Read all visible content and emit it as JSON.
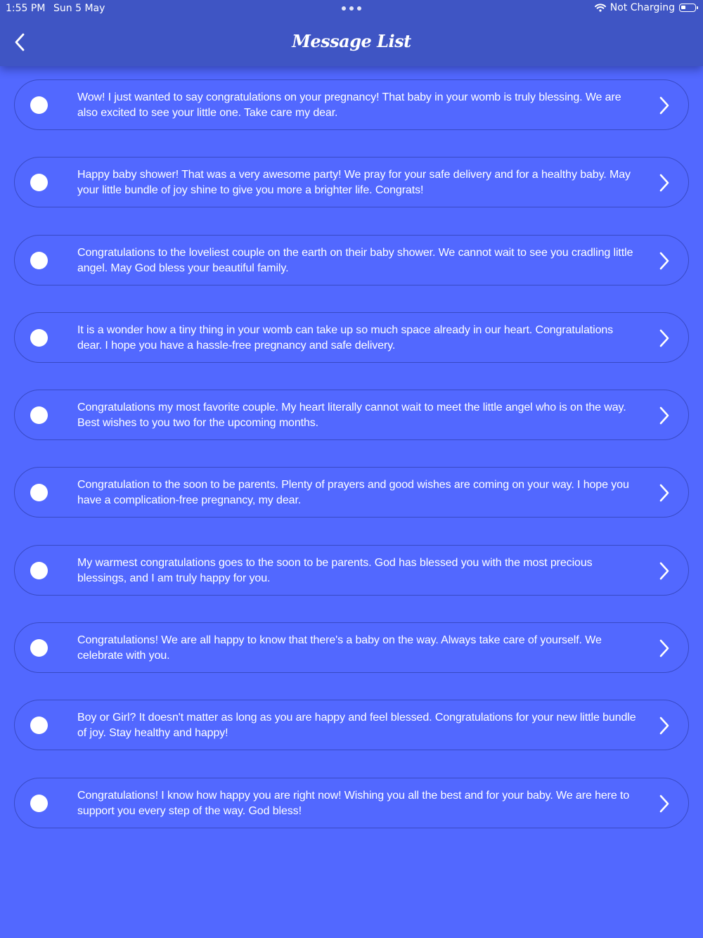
{
  "status_bar": {
    "time": "1:55 PM",
    "date": "Sun 5 May",
    "battery_text": "Not Charging"
  },
  "header": {
    "title": "Message List",
    "back_icon": "chevron-left-icon"
  },
  "colors": {
    "background": "#5268ff",
    "header": "#3f55c4",
    "text": "#ffffff"
  },
  "messages": [
    {
      "text": "Wow! I just wanted to say congratulations on your pregnancy! That baby in your womb is truly blessing. We are also excited to see your little one. Take care my dear."
    },
    {
      "text": "Happy baby shower! That was a very awesome party! We pray for your safe delivery and for a healthy baby. May your little bundle of joy shine to give you more a brighter life. Congrats!"
    },
    {
      "text": "Congratulations to the loveliest couple on the earth on their baby shower. We cannot wait to see you cradling little angel. May God bless your beautiful family."
    },
    {
      "text": "It is a wonder how a tiny thing in your womb can take up so much space already in our heart. Congratulations dear. I hope you have a hassle-free pregnancy and safe delivery."
    },
    {
      "text": "Congratulations my most favorite couple. My heart literally cannot wait to meet the little angel who is on the way. Best wishes to you two for the upcoming months."
    },
    {
      "text": "Congratulation to the soon to be parents. Plenty of prayers and good wishes are coming on your way. I hope you have a complication-free pregnancy, my dear."
    },
    {
      "text": "My warmest congratulations goes to the soon to be parents. God has blessed you with the most precious blessings, and I am truly happy for you."
    },
    {
      "text": "Congratulations! We are all happy to know that there's a baby on the way. Always take care of yourself. We celebrate with you."
    },
    {
      "text": "Boy or Girl? It doesn't matter as long as you are happy and feel blessed. Congratulations for your new little bundle of joy. Stay healthy and happy!"
    },
    {
      "text": "Congratulations! I know how happy you are right now! Wishing you all the best and for your baby. We are here to support you every step of the way. God bless!"
    }
  ]
}
